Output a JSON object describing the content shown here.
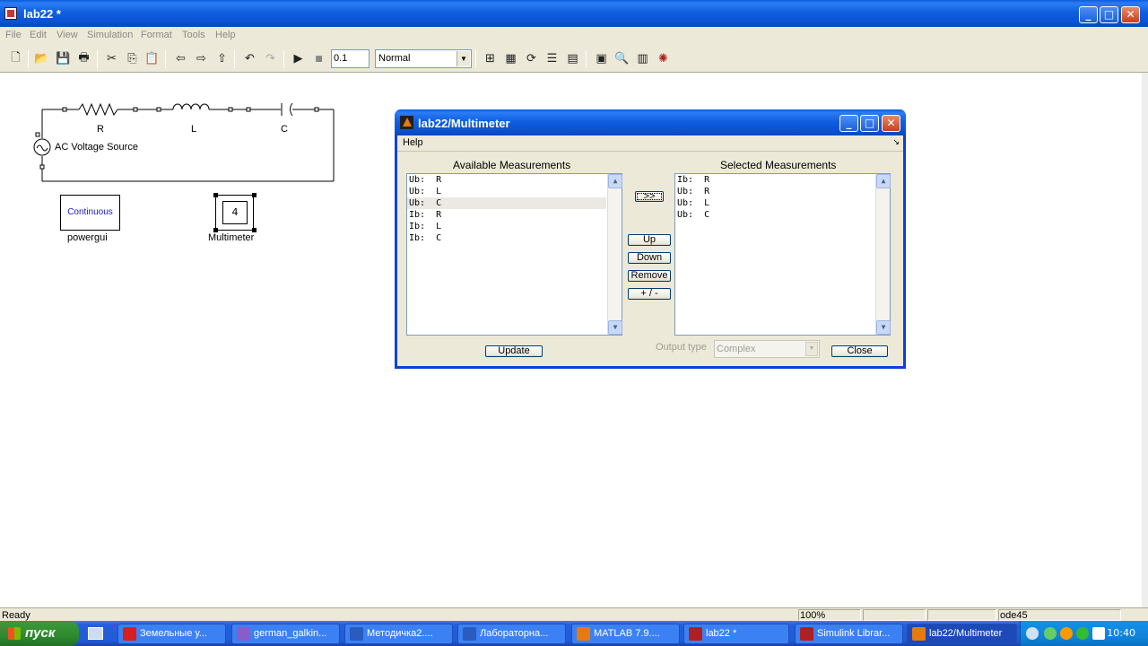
{
  "window": {
    "title": "lab22 *",
    "controls": [
      "_",
      "□",
      "✕"
    ]
  },
  "menu": [
    "File",
    "Edit",
    "View",
    "Simulation",
    "Format",
    "Tools",
    "Help"
  ],
  "toolbar": {
    "stop_time": "0.1",
    "sim_mode": "Normal"
  },
  "model": {
    "resistor_label": "R",
    "inductor_label": "L",
    "capacitor_label": "C",
    "source_label": "AC Voltage Source",
    "powergui_text": "Continuous",
    "powergui_label": "powergui",
    "multimeter_count": "4",
    "multimeter_label": "Multimeter"
  },
  "dialog": {
    "title": "lab22/Multimeter",
    "menu_help": "Help",
    "available_title": "Available Measurements",
    "available": [
      "Ub:  R",
      "Ub:  L",
      "Ub:  C",
      "Ib:  R",
      "Ib:  L",
      "Ib:  C"
    ],
    "selected_title": "Selected Measurements",
    "selected": [
      "Ib:  R",
      "Ub:  R",
      "Ub:  L",
      "Ub:  C"
    ],
    "add_label": ">>",
    "up_label": "Up",
    "down_label": "Down",
    "remove_label": "Remove",
    "sign_label": "+ / -",
    "update_label": "Update",
    "output_type_label": "Output type",
    "output_type_value": "Complex",
    "close_label": "Close"
  },
  "status": {
    "text": "Ready",
    "zoom": "100%",
    "solver": "ode45"
  },
  "taskbar": {
    "start_label": "пуск",
    "items": [
      {
        "label": "Земельные у...",
        "color": "#d81e1e"
      },
      {
        "label": "german_galkin...",
        "color": "#8a5cc9"
      },
      {
        "label": "Методичка2....",
        "color": "#2a5bbf"
      },
      {
        "label": "Лабораторна...",
        "color": "#2a5bbf"
      },
      {
        "label": "MATLAB  7.9....",
        "color": "#e67a10"
      },
      {
        "label": "lab22 *",
        "color": "#b02020"
      },
      {
        "label": "Simulink Librar...",
        "color": "#b02020"
      },
      {
        "label": "lab22/Multimeter",
        "color": "#e67a10"
      }
    ],
    "clock": "10:40"
  }
}
